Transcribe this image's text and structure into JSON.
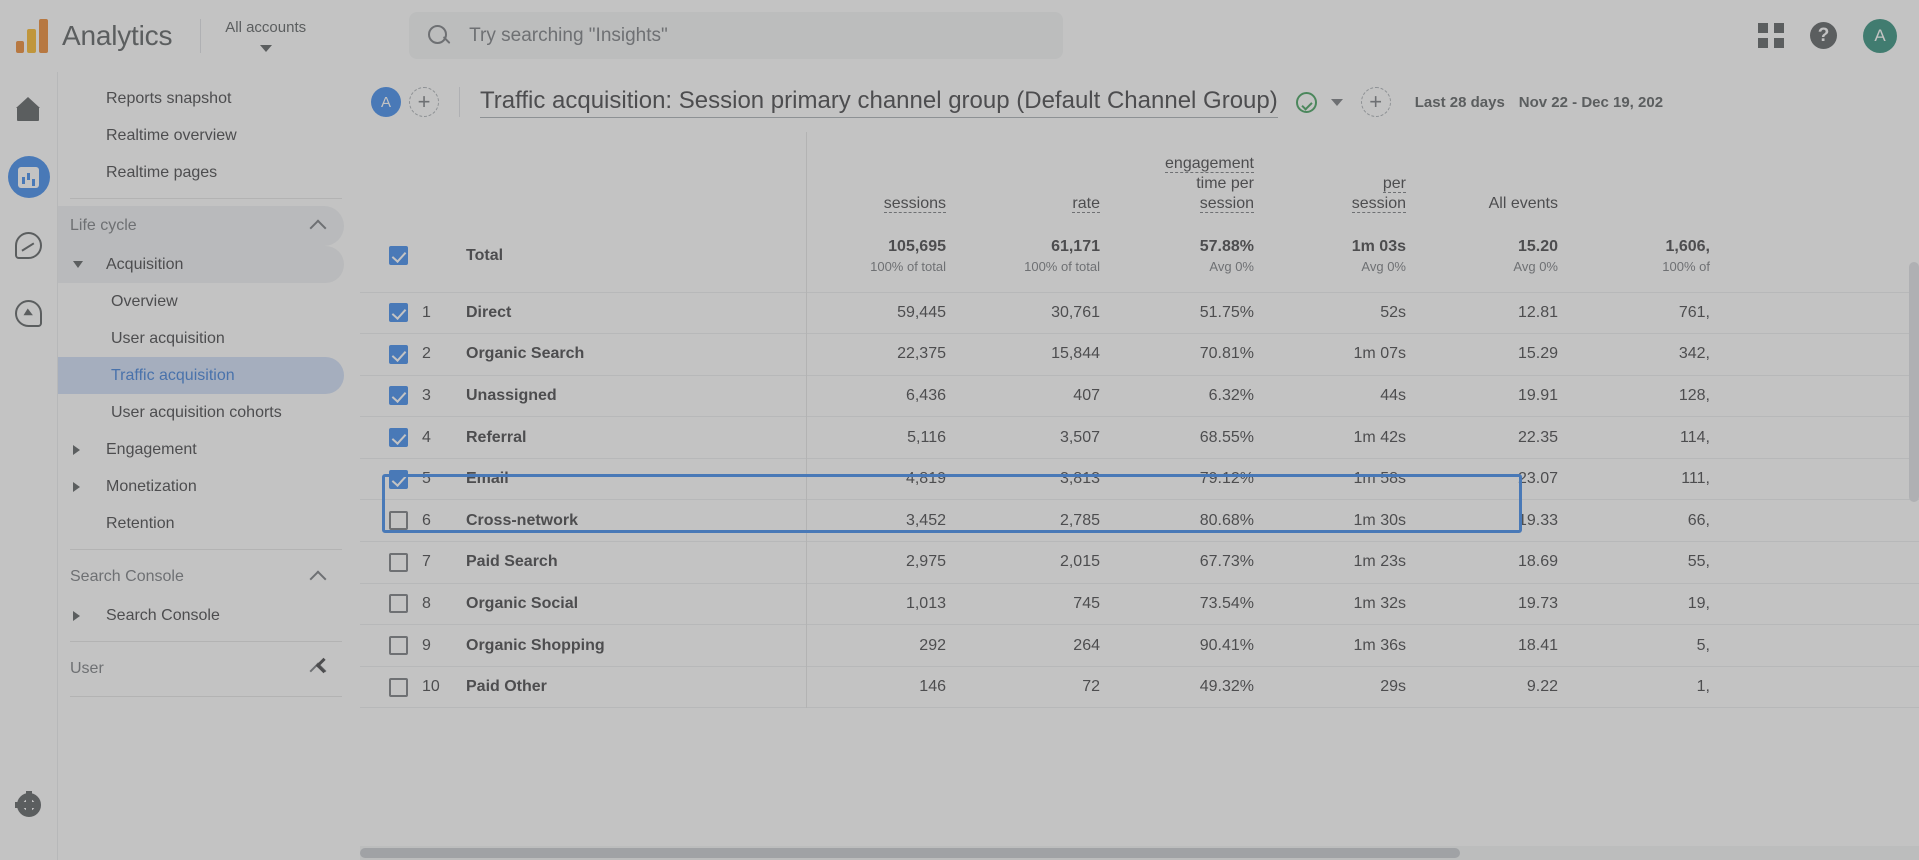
{
  "appbar": {
    "brand": "Analytics",
    "account_selector": "All accounts",
    "search_placeholder": "Try searching \"Insights\"",
    "apps_icon": "apps-grid-icon",
    "help_icon": "help-icon",
    "help_glyph": "?",
    "avatar_initial": "A"
  },
  "rail": {
    "items": [
      {
        "name": "home",
        "icon": "home-icon"
      },
      {
        "name": "reports",
        "icon": "reports-bar-chart-icon"
      },
      {
        "name": "explore",
        "icon": "explore-icon"
      },
      {
        "name": "advertising",
        "icon": "advertising-target-icon"
      }
    ],
    "settings_icon": "gear-icon"
  },
  "sidebar": {
    "items": [
      {
        "label": "Reports snapshot",
        "type": "item"
      },
      {
        "label": "Realtime overview",
        "type": "item"
      },
      {
        "label": "Realtime pages",
        "type": "item"
      }
    ],
    "sections": [
      {
        "label": "Life cycle",
        "collapse_icon": "chevron-up-icon",
        "children": [
          {
            "label": "Acquisition",
            "type": "group",
            "expanded": true,
            "highlighted": true
          },
          {
            "label": "Overview",
            "type": "sub"
          },
          {
            "label": "User acquisition",
            "type": "sub"
          },
          {
            "label": "Traffic acquisition",
            "type": "sub",
            "selected": true
          },
          {
            "label": "User acquisition cohorts",
            "type": "sub"
          },
          {
            "label": "Engagement",
            "type": "group",
            "expanded": false
          },
          {
            "label": "Monetization",
            "type": "group",
            "expanded": false
          },
          {
            "label": "Retention",
            "type": "item"
          }
        ]
      },
      {
        "label": "Search Console",
        "collapse_icon": "chevron-up-icon",
        "children": [
          {
            "label": "Search Console",
            "type": "group",
            "expanded": false
          }
        ]
      },
      {
        "label": "User",
        "collapse_icon": "chevron-up-icon",
        "children": []
      }
    ],
    "collapse_icon": "chevron-left-icon"
  },
  "report": {
    "avatar_initial": "A",
    "add_icon": "plus-icon",
    "title": "Traffic acquisition: Session primary channel group (Default Channel Group)",
    "validated_icon": "check-circle-icon",
    "dropdown_icon": "caret-down-icon",
    "add_comparison_icon": "plus-icon",
    "date_preset": "Last 28 days",
    "date_range": "Nov 22 - Dec 19, 202"
  },
  "table": {
    "headers": [
      {
        "lines": [
          "sessions"
        ],
        "underlined": [
          true
        ]
      },
      {
        "lines": [
          "rate"
        ],
        "underlined": [
          true
        ]
      },
      {
        "lines": [
          "engagement",
          "time per",
          "session"
        ],
        "underlined": [
          true,
          false,
          true
        ]
      },
      {
        "lines": [
          "per",
          "session"
        ],
        "underlined": [
          true,
          true
        ]
      },
      {
        "lines": [
          "All events"
        ],
        "underlined": [
          false
        ]
      }
    ],
    "total_row": {
      "label": "Total",
      "checked": true,
      "values": [
        "105,695",
        "61,171",
        "57.88%",
        "1m 03s",
        "15.20",
        "1,606,"
      ],
      "subvalues": [
        "100% of total",
        "100% of total",
        "Avg 0%",
        "Avg 0%",
        "Avg 0%",
        "100% of"
      ]
    },
    "rows": [
      {
        "rank": "1",
        "name": "Direct",
        "checked": true,
        "values": [
          "59,445",
          "30,761",
          "51.75%",
          "52s",
          "12.81",
          "761,"
        ]
      },
      {
        "rank": "2",
        "name": "Organic Search",
        "checked": true,
        "values": [
          "22,375",
          "15,844",
          "70.81%",
          "1m 07s",
          "15.29",
          "342,"
        ]
      },
      {
        "rank": "3",
        "name": "Unassigned",
        "checked": true,
        "values": [
          "6,436",
          "407",
          "6.32%",
          "44s",
          "19.91",
          "128,"
        ],
        "highlighted": true
      },
      {
        "rank": "4",
        "name": "Referral",
        "checked": true,
        "values": [
          "5,116",
          "3,507",
          "68.55%",
          "1m 42s",
          "22.35",
          "114,"
        ]
      },
      {
        "rank": "5",
        "name": "Email",
        "checked": true,
        "values": [
          "4,819",
          "3,813",
          "79.12%",
          "1m 58s",
          "23.07",
          "111,"
        ]
      },
      {
        "rank": "6",
        "name": "Cross-network",
        "checked": false,
        "values": [
          "3,452",
          "2,785",
          "80.68%",
          "1m 30s",
          "19.33",
          "66,"
        ]
      },
      {
        "rank": "7",
        "name": "Paid Search",
        "checked": false,
        "values": [
          "2,975",
          "2,015",
          "67.73%",
          "1m 23s",
          "18.69",
          "55,"
        ]
      },
      {
        "rank": "8",
        "name": "Organic Social",
        "checked": false,
        "values": [
          "1,013",
          "745",
          "73.54%",
          "1m 32s",
          "19.73",
          "19,"
        ]
      },
      {
        "rank": "9",
        "name": "Organic Shopping",
        "checked": false,
        "values": [
          "292",
          "264",
          "90.41%",
          "1m 36s",
          "18.41",
          "5,"
        ]
      },
      {
        "rank": "10",
        "name": "Paid Other",
        "checked": false,
        "values": [
          "146",
          "72",
          "49.32%",
          "29s",
          "9.22",
          "1,"
        ]
      }
    ]
  },
  "colors": {
    "brand_orange": "#E8710A",
    "brand_yellow": "#F9AB00",
    "accent_blue": "#1a73e8",
    "selected_nav_bg": "#c7d7f5",
    "selected_nav_text": "#1967d2",
    "avatar_green": "#0b7a62",
    "check_green": "#1e8e3e"
  }
}
